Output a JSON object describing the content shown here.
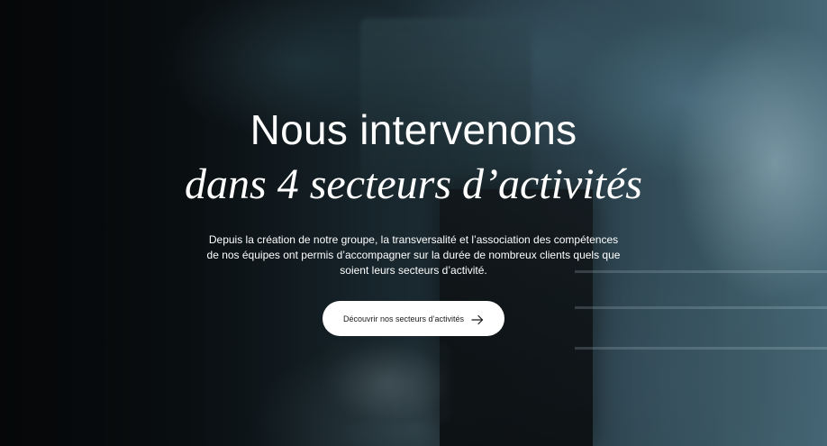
{
  "hero": {
    "title_line1": "Nous intervenons",
    "title_line2": "dans 4 secteurs d’activités",
    "description": "Depuis la création de notre groupe, la transversalité et l’association des compétences de nos équipes ont permis d’accompagner sur la durée de nombreux clients quels que soient leurs secteurs d’activité.",
    "cta_label": "Découvrir nos secteurs d’activités",
    "cta_icon": "arrow-right-icon"
  },
  "colors": {
    "text": "#ffffff",
    "button_bg": "#ffffff",
    "button_text": "#1a1a1a"
  }
}
